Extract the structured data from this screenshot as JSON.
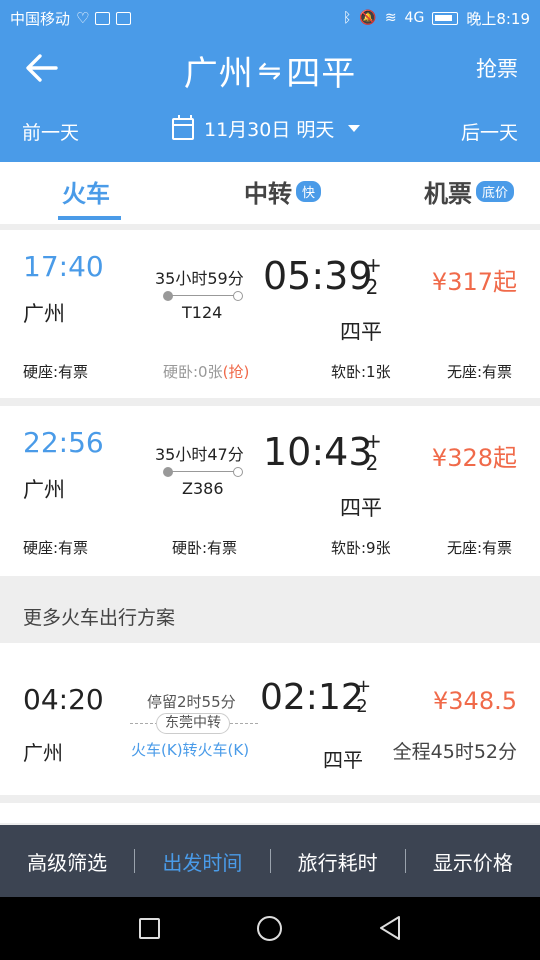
{
  "status_bar": {
    "carrier": "中国移动",
    "network": "4G",
    "time": "晚上8:19"
  },
  "header": {
    "from": "广州",
    "swap_glyph": "⇋",
    "to": "四平",
    "grab_label": "抢票",
    "prev_day": "前一天",
    "next_day": "后一天",
    "date": "11月30日 明天"
  },
  "tabs": [
    {
      "label": "火车",
      "badge": ""
    },
    {
      "label": "中转",
      "badge": "快"
    },
    {
      "label": "机票",
      "badge": "底价"
    }
  ],
  "trains": [
    {
      "depart": "17:40",
      "from": "广州",
      "duration": "35小时59分",
      "number": "T124",
      "arrive": "05:39",
      "plus": "+",
      "day_offset": "2",
      "to": "四平",
      "price": "¥317起",
      "seats": {
        "s1": "硬座:有票",
        "s2": "硬卧:0张",
        "s2_grab": "(抢)",
        "s3": "软卧:1张",
        "s4": "无座:有票"
      }
    },
    {
      "depart": "22:56",
      "from": "广州",
      "duration": "35小时47分",
      "number": "Z386",
      "arrive": "10:43",
      "plus": "+",
      "day_offset": "2",
      "to": "四平",
      "price": "¥328起",
      "seats": {
        "s1": "硬座:有票",
        "s2": "硬卧:有票",
        "s3": "软卧:9张",
        "s4": "无座:有票"
      }
    }
  ],
  "more_title": "更多火车出行方案",
  "transfer_plan": {
    "depart": "04:20",
    "from": "广州",
    "stay": "停留2时55分",
    "station": "东莞中转",
    "mode": "火车(K)转火车(K)",
    "arrive": "02:12",
    "plus": "+",
    "day_offset": "2",
    "to": "四平",
    "price": "¥348.5",
    "total": "全程45时52分"
  },
  "filter_bar": {
    "advanced": "高级筛选",
    "depart_time": "出发时间",
    "travel_time": "旅行耗时",
    "show_price": "显示价格"
  },
  "colors": {
    "primary": "#4a9be8",
    "price": "#f06a4a",
    "filter_bg": "#3c4452"
  }
}
